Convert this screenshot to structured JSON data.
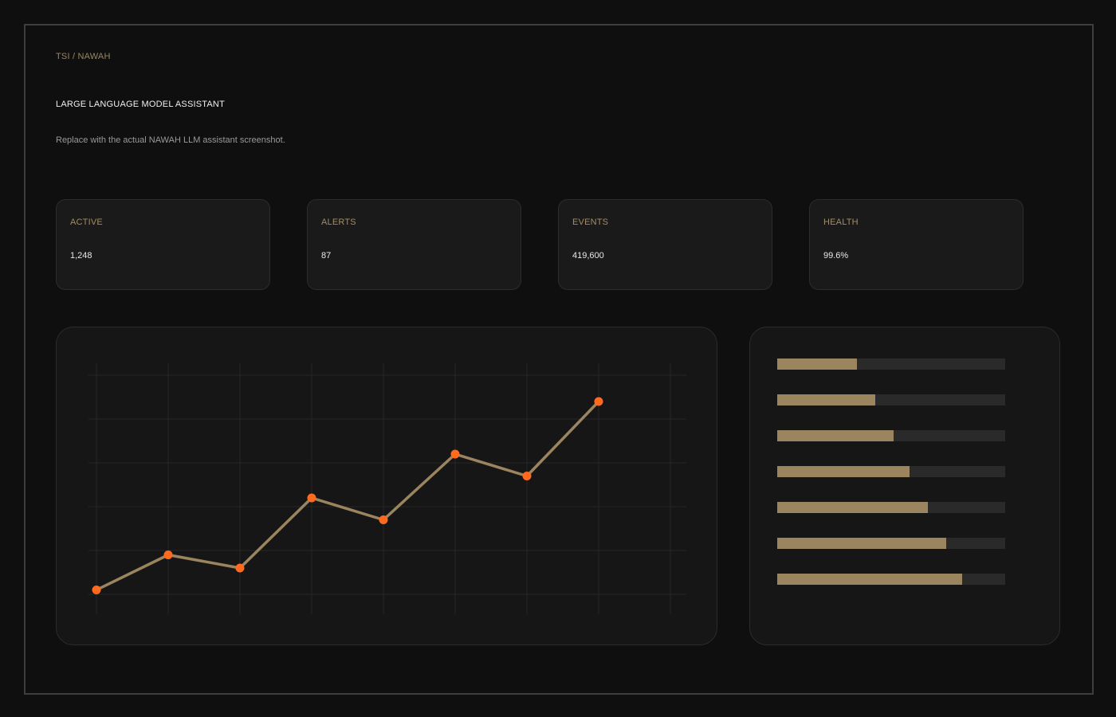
{
  "header": {
    "breadcrumb": "TSI / NAWAH",
    "title": "LARGE LANGUAGE MODEL ASSISTANT",
    "subtitle": "Replace with the actual NAWAH LLM assistant screenshot."
  },
  "stats": [
    {
      "label": "ACTIVE",
      "value": "1,248"
    },
    {
      "label": "ALERTS",
      "value": "87"
    },
    {
      "label": "EVENTS",
      "value": "419,600"
    },
    {
      "label": "HEALTH",
      "value": "99.6%"
    }
  ],
  "colors": {
    "accent": "#9a855f",
    "point": "#ff6a1f",
    "track": "#2a2a2a",
    "grid": "#262626"
  },
  "chart_data": [
    {
      "type": "line",
      "x": [
        1,
        2,
        3,
        4,
        5,
        6,
        7,
        8,
        9
      ],
      "series": [
        {
          "values": [
            0.2,
            1.8,
            1.2,
            4.4,
            3.4,
            6.4,
            5.4,
            8.8,
            null
          ]
        }
      ],
      "ylim": [
        0,
        10
      ],
      "grid": true
    },
    {
      "type": "bar",
      "orientation": "horizontal",
      "values": [
        0.35,
        0.43,
        0.51,
        0.58,
        0.66,
        0.74,
        0.81
      ],
      "ylim": [
        0,
        1
      ]
    }
  ]
}
